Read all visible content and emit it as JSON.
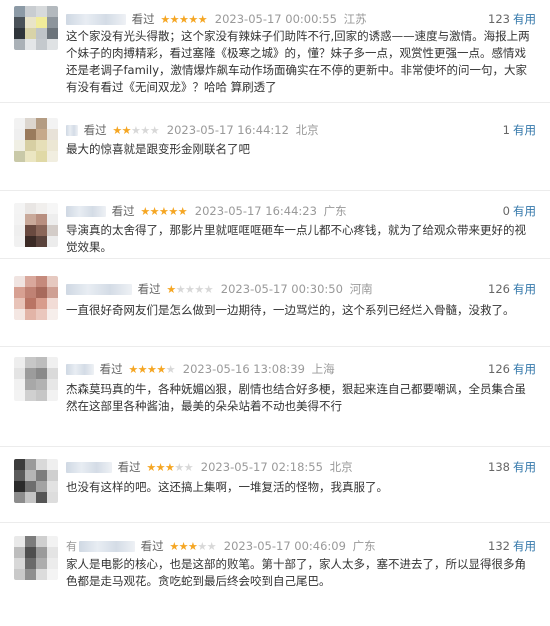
{
  "reviews": [
    {
      "prefix": "",
      "status": "看过",
      "stars": "★★★★★",
      "stars_off": "",
      "time": "2023-05-17 00:00:55",
      "location": "江苏",
      "useful_count": "123",
      "useful_label": "有用",
      "content": "这个家没有光头得散；这个家没有辣妹子们助阵不行,回家的诱惑——速度与激情。海报上两个妹子的肉搏精彩，看过塞隆《极寒之城》的，懂？妹子多一点，观赏性更强一点。感情戏还是老调子family，激情爆炸飙车动作场面确实在不停的更新中。非常使坏的问一句，大家有没有看过《无间双龙》？哈哈 算刷透了"
    },
    {
      "prefix": "",
      "status": "看过",
      "stars": "★★",
      "stars_off": "★★★",
      "time": "2023-05-17 16:44:12",
      "location": "北京",
      "useful_count": "1",
      "useful_label": "有用",
      "content": "最大的惊喜就是跟变形金刚联名了吧"
    },
    {
      "prefix": "",
      "status": "看过",
      "stars": "★★★★★",
      "stars_off": "",
      "time": "2023-05-17 16:44:23",
      "location": "广东",
      "useful_count": "0",
      "useful_label": "有用",
      "content": "导演真的太舍得了，那影片里就哐哐哐砸车一点儿都不心疼钱，就为了给观众带来更好的视觉效果。"
    },
    {
      "prefix": "",
      "status": "看过",
      "stars": "★",
      "stars_off": "★★★★",
      "time": "2023-05-17 00:30:50",
      "location": "河南",
      "useful_count": "126",
      "useful_label": "有用",
      "content": "一直很好奇网友们是怎么做到一边期待，一边骂烂的，这个系列已经烂入骨髓，没救了。"
    },
    {
      "prefix": "",
      "status": "看过",
      "stars": "★★★★",
      "stars_off": "★",
      "time": "2023-05-16 13:08:39",
      "location": "上海",
      "useful_count": "126",
      "useful_label": "有用",
      "content": "杰森莫玛真的牛，各种妩媚凶狠，剧情也结合好多梗，狠起来连自己都要嘲讽，全员集合虽然在这部里各种酱油，最美的朵朵站着不动也美得不行"
    },
    {
      "prefix": "",
      "status": "看过",
      "stars": "★★★",
      "stars_off": "★★",
      "time": "2023-05-17 02:18:55",
      "location": "北京",
      "useful_count": "138",
      "useful_label": "有用",
      "content": "也没有这样的吧。这还搞上集啊，一堆复活的怪物，我真服了。"
    },
    {
      "prefix": "有",
      "status": "看过",
      "stars": "★★★",
      "stars_off": "★★",
      "time": "2023-05-17 00:46:09",
      "location": "广东",
      "useful_count": "132",
      "useful_label": "有用",
      "content": "家人是电影的核心，也是这部的败笔。第十部了，家人太多，塞不进去了，所以显得很多角色都是走马观花。贪吃蛇到最后终会咬到自己尾巴。"
    }
  ]
}
